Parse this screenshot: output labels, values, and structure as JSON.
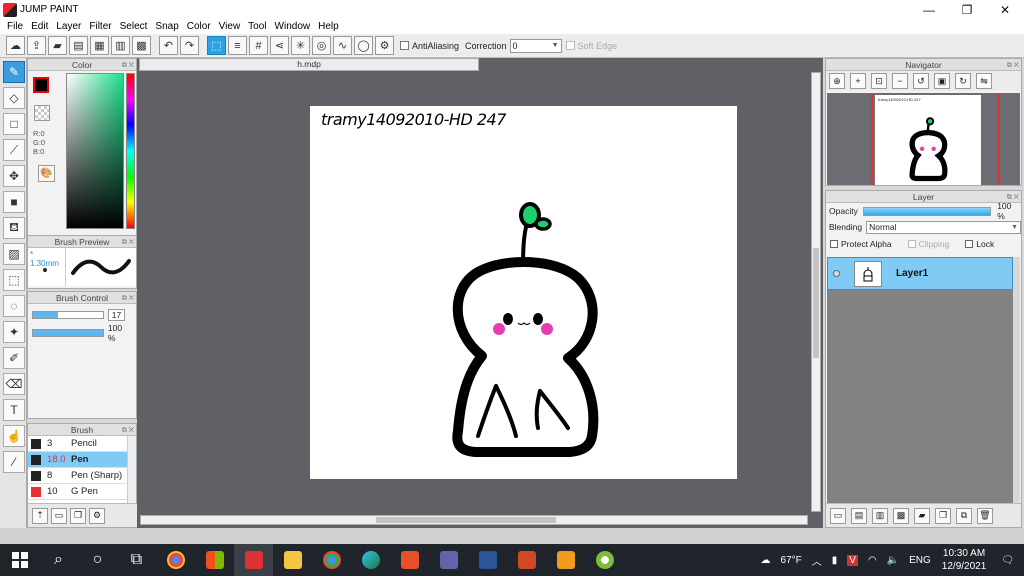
{
  "window": {
    "title": "JUMP PAINT",
    "minimize": "—",
    "maximize": "❐",
    "close": "✕"
  },
  "menu": [
    "File",
    "Edit",
    "Layer",
    "Filter",
    "Select",
    "Snap",
    "Color",
    "View",
    "Tool",
    "Window",
    "Help"
  ],
  "toolbar": {
    "antialiasing_label": "AntiAliasing",
    "correction_label": "Correction",
    "correction_value": "0",
    "soft_edge_label": "Soft Edge"
  },
  "color_panel": {
    "title": "Color",
    "r": "R:0",
    "g": "G:0",
    "b": "B:0",
    "foreground": "#000000"
  },
  "brush_preview": {
    "title": "Brush Preview",
    "size": "* 1.30mm"
  },
  "brush_control": {
    "title": "Brush Control",
    "size_value": "17",
    "size_fraction": 0.36,
    "opacity_value": "100 %",
    "opacity_fraction": 1.0
  },
  "brush_panel": {
    "title": "Brush",
    "items": [
      {
        "size": "3",
        "name": "Pencil",
        "swatch": "#222222",
        "selected": false
      },
      {
        "size": "18.0",
        "name": "Pen",
        "swatch": "#222222",
        "selected": true
      },
      {
        "size": "8",
        "name": "Pen (Sharp)",
        "swatch": "#222222",
        "selected": false
      },
      {
        "size": "10",
        "name": "G Pen",
        "swatch": "#e83030",
        "selected": false
      }
    ]
  },
  "document": {
    "tab": "h.mdp",
    "signature": "tramy14092010-HD 247"
  },
  "navigator": {
    "title": "Navigator",
    "thumb_text": "tramy14092010-HD 247"
  },
  "layer_panel": {
    "title": "Layer",
    "opacity_label": "Opacity",
    "opacity_value": "100 %",
    "opacity_fraction": 1.0,
    "blending_label": "Blending",
    "blending_value": "Normal",
    "protect_alpha": "Protect Alpha",
    "clipping": "Clipping",
    "lock": "Lock",
    "layers": [
      {
        "name": "Layer1",
        "selected": true
      }
    ]
  },
  "taskbar": {
    "weather": "67°F",
    "language": "ENG",
    "time": "10:30 AM",
    "date": "12/9/2021"
  },
  "colors": {
    "accent": "#29a3e6",
    "selection": "#7fcbf5",
    "sprout": "#1bd16f",
    "blush": "#e040b0"
  }
}
